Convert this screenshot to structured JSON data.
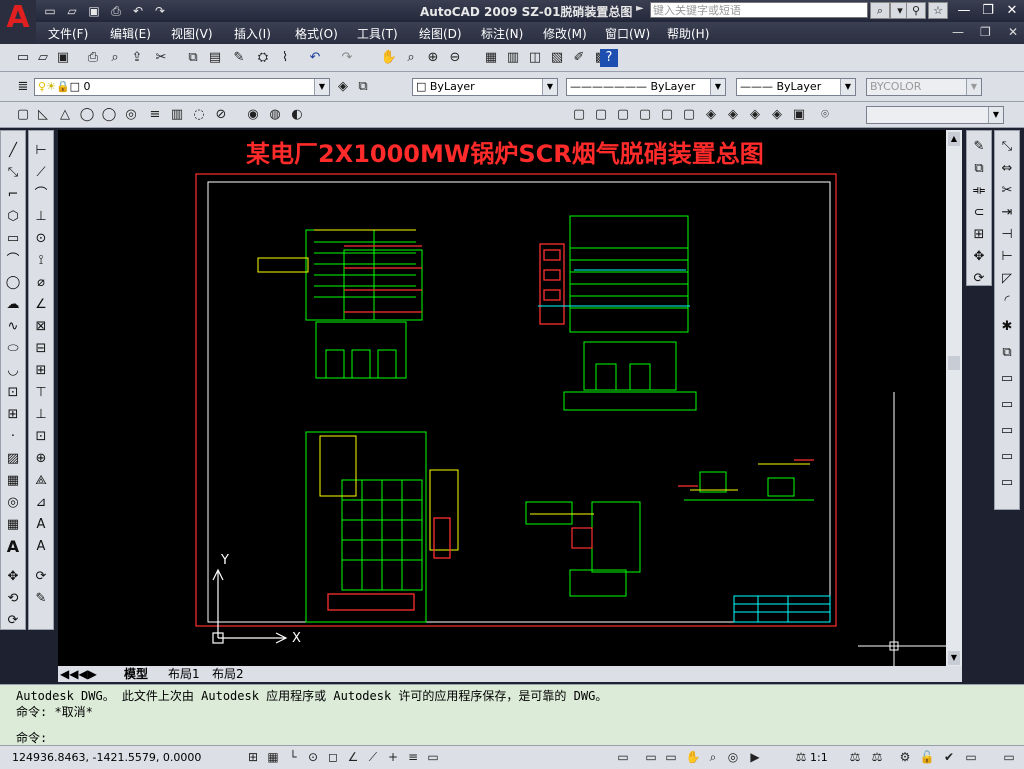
{
  "window": {
    "title": "AutoCAD 2009  SZ-01脱硝装置总图",
    "search_placeholder": "键入关键字或短语"
  },
  "menu": [
    "文件(F)",
    "编辑(E)",
    "视图(V)",
    "插入(I)",
    "格式(O)",
    "工具(T)",
    "绘图(D)",
    "标注(N)",
    "修改(M)",
    "窗口(W)",
    "帮助(H)"
  ],
  "layers": {
    "current_layer": "0",
    "color": "ByLayer",
    "linetype": "ByLayer",
    "lineweight": "ByLayer",
    "plotstyle": "BYCOLOR"
  },
  "drawing": {
    "title": "某电厂2X1000MW锅炉SCR烟气脱硝装置总图",
    "ucs_y": "Y",
    "ucs_x": "X"
  },
  "tabs": [
    "模型",
    "布局1",
    "布局2"
  ],
  "command": {
    "line1": "Autodesk DWG。  此文件上次由 Autodesk 应用程序或 Autodesk 许可的应用程序保存，是可靠的 DWG。",
    "line2": "命令: *取消*",
    "prompt": "命令:"
  },
  "status": {
    "coords": "124936.8463, -1421.5579, 0.0000",
    "scale": "1:1"
  },
  "colors": {
    "titlebar": "#2a2e40",
    "canvas": "#000000",
    "command_bg": "#dcebd8",
    "title_red": "#ff2a2a",
    "line_green": "#00ff00",
    "line_yellow": "#ffff00",
    "line_cyan": "#00ffff"
  }
}
